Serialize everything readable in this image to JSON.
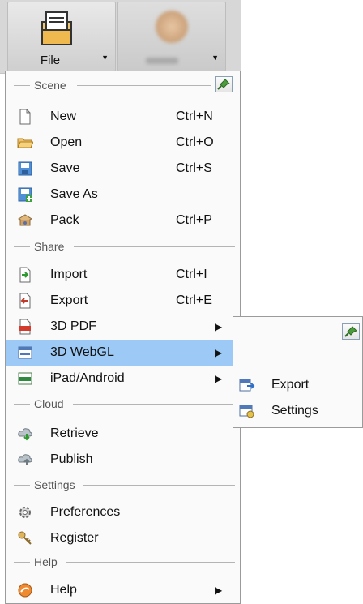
{
  "ribbon": {
    "file_label": "File",
    "dropdown_glyph": "▼"
  },
  "menu": {
    "sections": [
      {
        "title": "Scene",
        "items": [
          {
            "label": "New",
            "shortcut": "Ctrl+N",
            "icon": "new-document-icon"
          },
          {
            "label": "Open",
            "shortcut": "Ctrl+O",
            "icon": "open-folder-icon"
          },
          {
            "label": "Save",
            "shortcut": "Ctrl+S",
            "icon": "save-icon"
          },
          {
            "label": "Save As",
            "shortcut": "",
            "icon": "save-as-icon"
          },
          {
            "label": "Pack",
            "shortcut": "Ctrl+P",
            "icon": "pack-icon"
          }
        ]
      },
      {
        "title": "Share",
        "items": [
          {
            "label": "Import",
            "shortcut": "Ctrl+I",
            "icon": "import-icon"
          },
          {
            "label": "Export",
            "shortcut": "Ctrl+E",
            "icon": "export-icon"
          },
          {
            "label": "3D PDF",
            "shortcut": "",
            "icon": "pdf-icon",
            "submenu": true
          },
          {
            "label": "3D WebGL",
            "shortcut": "",
            "icon": "webgl-icon",
            "submenu": true,
            "highlighted": true
          },
          {
            "label": "iPad/Android",
            "shortcut": "",
            "icon": "mobile-icon",
            "submenu": true
          }
        ]
      },
      {
        "title": "Cloud",
        "items": [
          {
            "label": "Retrieve",
            "shortcut": "",
            "icon": "cloud-retrieve-icon"
          },
          {
            "label": "Publish",
            "shortcut": "",
            "icon": "cloud-publish-icon"
          }
        ]
      },
      {
        "title": "Settings",
        "items": [
          {
            "label": "Preferences",
            "shortcut": "",
            "icon": "gear-icon"
          },
          {
            "label": "Register",
            "shortcut": "",
            "icon": "key-icon"
          }
        ]
      },
      {
        "title": "Help",
        "items": [
          {
            "label": "Help",
            "shortcut": "",
            "icon": "help-icon",
            "submenu": true
          }
        ]
      }
    ],
    "submenu_arrow": "▶"
  },
  "submenu_webgl": {
    "items": [
      {
        "label": "Export",
        "icon": "webgl-export-icon"
      },
      {
        "label": "Settings",
        "icon": "webgl-settings-icon"
      }
    ]
  }
}
